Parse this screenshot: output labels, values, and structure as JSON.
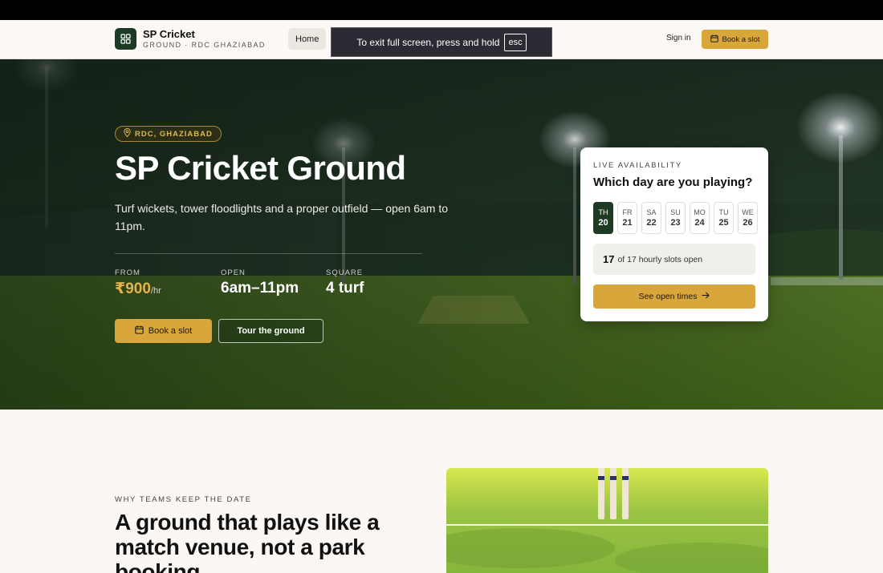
{
  "brand": {
    "name": "SP Cricket",
    "subtitle": "GROUND · RDC GHAZIABAD"
  },
  "nav": {
    "home_label": "Home",
    "signin_label": "Sign in",
    "book_label": "Book a slot"
  },
  "fullscreen_toast": {
    "message": "To exit full screen, press and hold",
    "key": "esc"
  },
  "hero": {
    "location": "RDC, GHAZIABAD",
    "title": "SP Cricket Ground",
    "description": "Turf wickets, tower floodlights and a proper outfield — open 6am to 11pm.",
    "stats": [
      {
        "label": "FROM",
        "value": "₹900",
        "unit": "/hr"
      },
      {
        "label": "OPEN",
        "value": "6am–11pm"
      },
      {
        "label": "SQUARE",
        "value": "4 turf"
      }
    ],
    "book_button": "Book a slot",
    "tour_button": "Tour the ground"
  },
  "availability": {
    "kicker": "LIVE AVAILABILITY",
    "title": "Which day are you playing?",
    "days": [
      {
        "dow": "TH",
        "num": "20",
        "selected": true
      },
      {
        "dow": "FR",
        "num": "21"
      },
      {
        "dow": "SA",
        "num": "22"
      },
      {
        "dow": "SU",
        "num": "23"
      },
      {
        "dow": "MO",
        "num": "24"
      },
      {
        "dow": "TU",
        "num": "25"
      },
      {
        "dow": "WE",
        "num": "26"
      }
    ],
    "slots_open": "17",
    "slots_text": "of 17 hourly slots open",
    "cta": "See open times"
  },
  "why": {
    "kicker": "WHY TEAMS KEEP THE DATE",
    "title": "A ground that plays like a match venue, not a park booking"
  },
  "colors": {
    "accent": "#d8a63a",
    "brand_green": "#1d3a25",
    "gold_text": "#e2b34a"
  }
}
